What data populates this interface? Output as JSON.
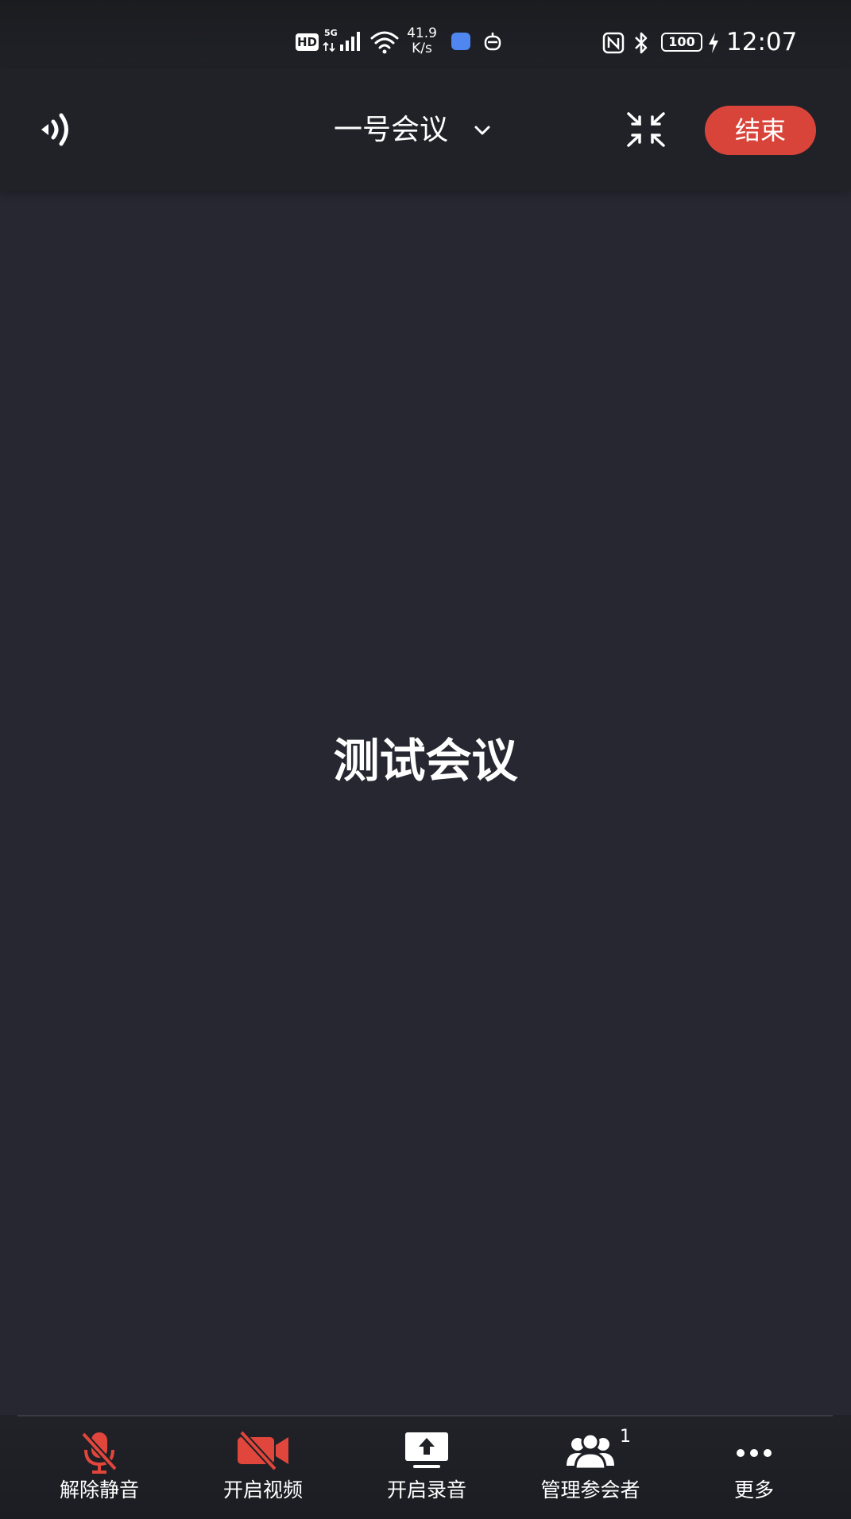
{
  "status_bar": {
    "hd": "HD",
    "network": "5G",
    "speed": "41.9\nK/s",
    "battery": "100",
    "time": "12:07"
  },
  "header": {
    "title": "一号会议",
    "end_label": "结束"
  },
  "main": {
    "label": "测试会议"
  },
  "toolbar": {
    "items": [
      {
        "label": "解除静音",
        "icon": "mic-off-icon"
      },
      {
        "label": "开启视频",
        "icon": "video-off-icon"
      },
      {
        "label": "开启录音",
        "icon": "screen-upload-icon"
      },
      {
        "label": "管理参会者",
        "icon": "participants-icon",
        "badge": "1"
      },
      {
        "label": "更多",
        "icon": "more-icon"
      }
    ]
  },
  "colors": {
    "background": "#272731",
    "accent_red": "#d9443a"
  }
}
